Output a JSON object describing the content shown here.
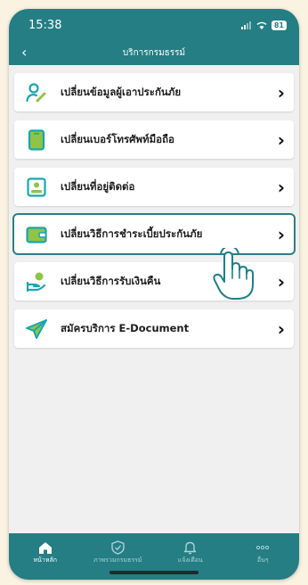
{
  "status_bar": {
    "time": "15:38",
    "battery": "81"
  },
  "nav": {
    "title": "บริการกรมธรรม์",
    "back_icon": "chevron-left-icon"
  },
  "menu": {
    "items": [
      {
        "label": "เปลี่ยนข้อมูลผู้เอาประกันภัย",
        "icon": "user-edit-icon"
      },
      {
        "label": "เปลี่ยนเบอร์โทรศัพท์มือถือ",
        "icon": "mobile-phone-icon"
      },
      {
        "label": "เปลี่ยนที่อยู่ติดต่อ",
        "icon": "contact-card-icon"
      },
      {
        "label": "เปลี่ยนวิธีการชำระเบี้ยประกันภัย",
        "icon": "wallet-icon",
        "selected": true
      },
      {
        "label": "เปลี่ยนวิธีการรับเงินคืน",
        "icon": "hand-coin-icon"
      },
      {
        "label": "สมัครบริการ E-Document",
        "icon": "paper-plane-icon"
      }
    ],
    "chevron": "›"
  },
  "tabs": [
    {
      "label": "หน้าหลัก",
      "icon": "home-icon",
      "active": true
    },
    {
      "label": "ภาพรวมกรมธรรม์",
      "icon": "shield-check-icon"
    },
    {
      "label": "แจ้งเตือน",
      "icon": "bell-icon"
    },
    {
      "label": "อื่นๆ",
      "icon": "more-dots-icon"
    }
  ],
  "colors": {
    "primary": "#247e84",
    "accent": "#17a6b0",
    "icon_green": "#8fc449",
    "background": "#fbf3e2"
  }
}
